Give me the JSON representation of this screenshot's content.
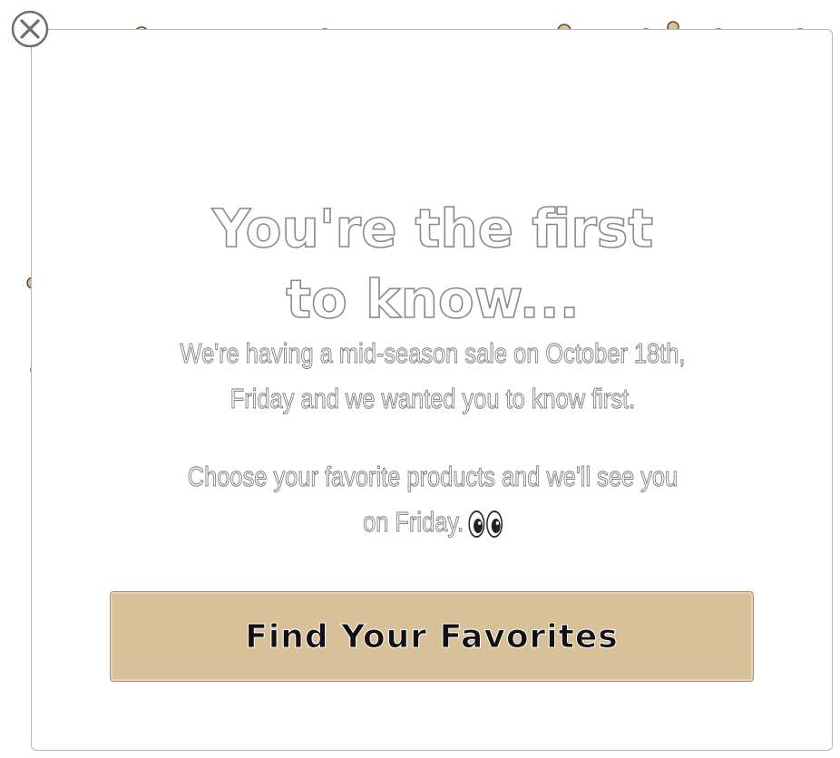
{
  "popup": {
    "headline": {
      "line1": "You're the first",
      "line2": "to know..."
    },
    "paragraph1": {
      "line1": "We're having a mid-season sale on October 18th,",
      "line2": "Friday and we wanted you to know first."
    },
    "paragraph2": {
      "line1": "Choose your favorite products and we'll see you",
      "line2": "on Friday."
    },
    "eyes_icon": "eyes-emoji",
    "cta_label": "Find Your Favorites",
    "close_icon": "close-x-icon"
  },
  "colors": {
    "confetti_gold": "#d8c198",
    "confetti_pale": "#f3e6c4",
    "button_fill": "#d8c198",
    "popup_border": "#b9b9b9"
  }
}
